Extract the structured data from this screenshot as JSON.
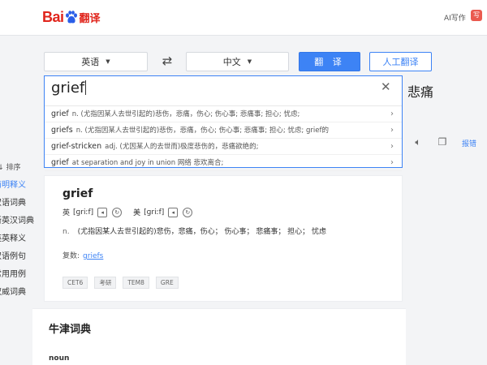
{
  "header": {
    "logo_bai": "Bai",
    "logo_fanyi": "翻译",
    "ai_link": "AI写作",
    "ai_icon": "写"
  },
  "lang_bar": {
    "source": "英语",
    "target": "中文",
    "translate_label": "翻 译",
    "human_label": "人工翻译"
  },
  "input": {
    "value": "grief"
  },
  "suggestions": [
    {
      "word": "grief",
      "text": "n. (尤指因某人去世引起的)悲伤，悲痛，伤心; 伤心事; 悲痛事; 担心; 忧虑;"
    },
    {
      "word": "griefs",
      "text": "n. (尤指因某人去世引起的)悲伤，悲痛，伤心; 伤心事; 悲痛事; 担心; 忧虑; grief的"
    },
    {
      "word": "grief-stricken",
      "text": "adj. (尤因某人的去世而)极度悲伤的，悲痛欲绝的;"
    },
    {
      "word": "grief",
      "text": "at separation and joy in union 网络 悲欢离合;"
    }
  ],
  "result": {
    "text": "悲痛",
    "share_label": "报错"
  },
  "side_nav": {
    "sort_label": "排序",
    "items": [
      "简明释义",
      "双语词典",
      "新英汉词典",
      "英英释义",
      "双语例句",
      "常用用例",
      "权威词典"
    ]
  },
  "dict": {
    "word": "grief",
    "uk_label": "英",
    "uk_ipa": "[ɡriːf]",
    "us_label": "美",
    "us_ipa": "[ɡriːf]",
    "pos": "n.",
    "definition": "(尤指因某人去世引起的)悲伤，悲痛，伤心； 伤心事； 悲痛事； 担心； 忧虑",
    "plural_label": "复数:",
    "plural_value": "griefs",
    "tags": [
      "CET6",
      "考研",
      "TEM8",
      "GRE"
    ]
  },
  "oxford": {
    "title": "牛津词典",
    "pos": "noun"
  }
}
